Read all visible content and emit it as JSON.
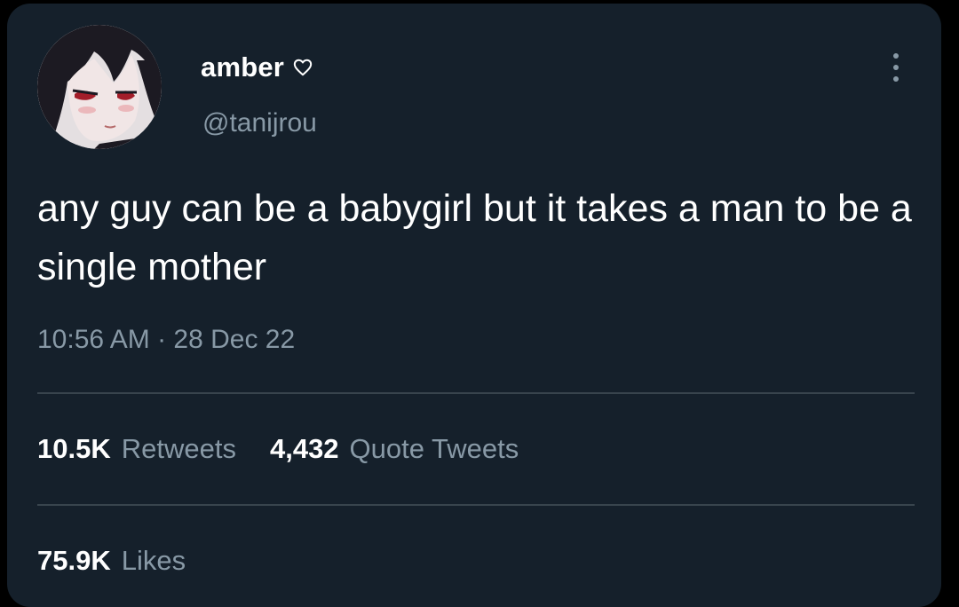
{
  "colors": {
    "background": "#15202b",
    "primary_text": "#ffffff",
    "secondary_text": "#8899a6",
    "divider": "#38444d"
  },
  "tweet": {
    "author": {
      "display_name": "amber",
      "name_icon": "heart-outline-icon",
      "handle": "@tanijrou",
      "avatar_icon": "anime-avatar"
    },
    "more_icon": "more-vertical-icon",
    "text": "any guy can be a babygirl but it takes a man to be a single mother",
    "timestamp": "10:56 AM · 28 Dec 22",
    "stats": {
      "retweets_count": "10.5K",
      "retweets_label": "Retweets",
      "quotes_count": "4,432",
      "quotes_label": "Quote Tweets",
      "likes_count": "75.9K",
      "likes_label": "Likes"
    }
  }
}
